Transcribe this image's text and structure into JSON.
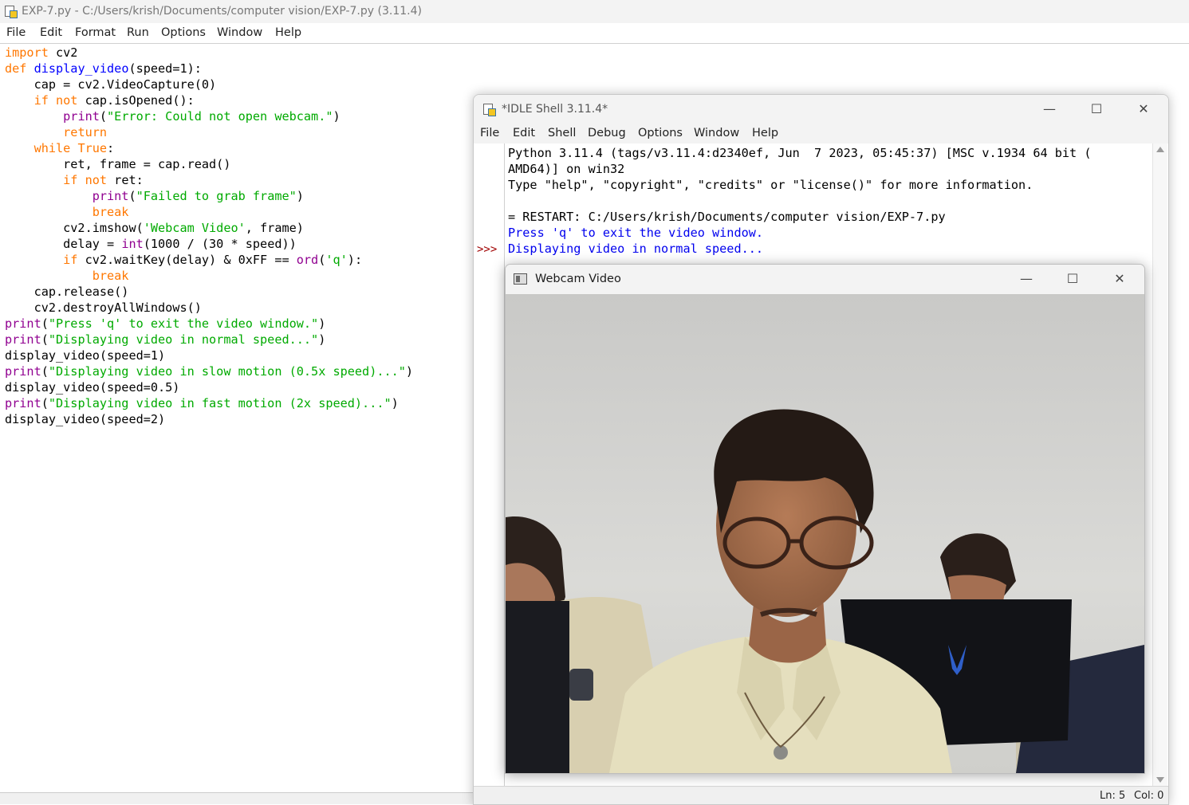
{
  "editor": {
    "title": "EXP-7.py - C:/Users/krish/Documents/computer vision/EXP-7.py (3.11.4)",
    "menu": [
      "File",
      "Edit",
      "Format",
      "Run",
      "Options",
      "Window",
      "Help"
    ],
    "code": [
      [
        [
          "kw",
          "import"
        ],
        [
          "t",
          " cv2"
        ]
      ],
      [
        [
          "kw",
          "def"
        ],
        [
          "t",
          " "
        ],
        [
          "df",
          "display_video"
        ],
        [
          "t",
          "(speed=1):"
        ]
      ],
      [
        [
          "t",
          "    cap = cv2.VideoCapture(0)"
        ]
      ],
      [
        [
          "t",
          "    "
        ],
        [
          "kw",
          "if not"
        ],
        [
          "t",
          " cap.isOpened():"
        ]
      ],
      [
        [
          "t",
          "        "
        ],
        [
          "bi",
          "print"
        ],
        [
          "t",
          "("
        ],
        [
          "st",
          "\"Error: Could not open webcam.\""
        ],
        [
          "t",
          ")"
        ]
      ],
      [
        [
          "t",
          "        "
        ],
        [
          "kw",
          "return"
        ]
      ],
      [
        [
          "t",
          "    "
        ],
        [
          "kw",
          "while"
        ],
        [
          "t",
          " "
        ],
        [
          "kw",
          "True"
        ],
        [
          "t",
          ":"
        ]
      ],
      [
        [
          "t",
          "        ret, frame = cap.read()"
        ]
      ],
      [
        [
          "t",
          "        "
        ],
        [
          "kw",
          "if not"
        ],
        [
          "t",
          " ret:"
        ]
      ],
      [
        [
          "t",
          "            "
        ],
        [
          "bi",
          "print"
        ],
        [
          "t",
          "("
        ],
        [
          "st",
          "\"Failed to grab frame\""
        ],
        [
          "t",
          ")"
        ]
      ],
      [
        [
          "t",
          "            "
        ],
        [
          "kw",
          "break"
        ]
      ],
      [
        [
          "t",
          "        cv2.imshow("
        ],
        [
          "st",
          "'Webcam Video'"
        ],
        [
          "t",
          ", frame)"
        ]
      ],
      [
        [
          "t",
          "        delay = "
        ],
        [
          "bi",
          "int"
        ],
        [
          "t",
          "(1000 / (30 * speed))"
        ]
      ],
      [
        [
          "t",
          "        "
        ],
        [
          "kw",
          "if"
        ],
        [
          "t",
          " cv2.waitKey(delay) & 0xFF == "
        ],
        [
          "bi",
          "ord"
        ],
        [
          "t",
          "("
        ],
        [
          "st",
          "'q'"
        ],
        [
          "t",
          "):"
        ]
      ],
      [
        [
          "t",
          "            "
        ],
        [
          "kw",
          "break"
        ]
      ],
      [
        [
          "t",
          "    cap.release()"
        ]
      ],
      [
        [
          "t",
          "    cv2.destroyAllWindows()"
        ]
      ],
      [
        [
          "bi",
          "print"
        ],
        [
          "t",
          "("
        ],
        [
          "st",
          "\"Press 'q' to exit the video window.\""
        ],
        [
          "t",
          ")"
        ]
      ],
      [
        [
          "bi",
          "print"
        ],
        [
          "t",
          "("
        ],
        [
          "st",
          "\"Displaying video in normal speed...\""
        ],
        [
          "t",
          ")"
        ]
      ],
      [
        [
          "t",
          "display_video(speed=1)"
        ]
      ],
      [
        [
          "bi",
          "print"
        ],
        [
          "t",
          "("
        ],
        [
          "st",
          "\"Displaying video in slow motion (0.5x speed)...\""
        ],
        [
          "t",
          ")"
        ]
      ],
      [
        [
          "t",
          "display_video(speed=0.5)"
        ]
      ],
      [
        [
          "bi",
          "print"
        ],
        [
          "t",
          "("
        ],
        [
          "st",
          "\"Displaying video in fast motion (2x speed)...\""
        ],
        [
          "t",
          ")"
        ]
      ],
      [
        [
          "t",
          "display_video(speed=2)"
        ]
      ]
    ]
  },
  "shell": {
    "title": "*IDLE Shell 3.11.4*",
    "menu": [
      "File",
      "Edit",
      "Shell",
      "Debug",
      "Options",
      "Window",
      "Help"
    ],
    "prompt": ">>>",
    "lines": [
      [
        [
          "t",
          "Python 3.11.4 (tags/v3.11.4:d2340ef, Jun  7 2023, 05:45:37) [MSC v.1934 64 bit ("
        ]
      ],
      [
        [
          "t",
          "AMD64)] on win32"
        ]
      ],
      [
        [
          "t",
          "Type \"help\", \"copyright\", \"credits\" or \"license()\" for more information."
        ]
      ],
      [
        [
          "t",
          ""
        ]
      ],
      [
        [
          "t",
          "= RESTART: C:/Users/krish/Documents/computer vision/EXP-7.py"
        ]
      ],
      [
        [
          "out",
          "Press 'q' to exit the video window."
        ]
      ],
      [
        [
          "out",
          "Displaying video in normal speed..."
        ]
      ]
    ],
    "status": {
      "ln": "Ln: 5",
      "col": "Col: 0"
    },
    "colors": {
      "stdout": "#0000ee",
      "prompt": "#a00000"
    }
  },
  "webcam": {
    "title": "Webcam Video"
  },
  "window_controls": {
    "minimize": "—",
    "maximize": "☐",
    "close": "✕"
  },
  "icons": [
    "python-file-icon",
    "minimize-icon",
    "maximize-icon",
    "close-icon",
    "webcam-window-icon"
  ]
}
